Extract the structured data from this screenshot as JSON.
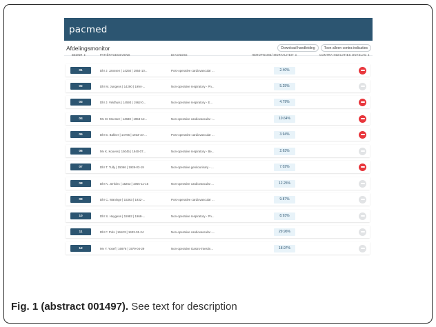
{
  "app": {
    "logo": "pacmed"
  },
  "header": {
    "title": "Afdelingsmonitor",
    "download_label": "Download handleiding",
    "filter_label": "Toon alleen contra-indicaties"
  },
  "columns": {
    "bed": "BEDNR ⇕",
    "patient": "PATIËNTGEGEVENS",
    "diagnosis": "DIAGNOSE",
    "risk": "HEROPNAME/ MORTALITEIT ⇕",
    "contra": "CONTRA-INDICATIES ONTSLAG ⇕"
  },
  "rows": [
    {
      "bed": "01",
      "patient": "Dhr J. Janssen | 14250 | 1954-10...",
      "diagnosis": "Post-operative cardiovascular ...",
      "risk": "2.40%",
      "contra": true
    },
    {
      "bed": "02",
      "patient": "Dhr M. Jungens | 14290 | 1994-...",
      "diagnosis": "Non-operative respiratory - Pn...",
      "risk": "5.25%",
      "contra": false
    },
    {
      "bed": "03",
      "patient": "Dhr J. Veldhuis | 14593 | 1962-0...",
      "diagnosis": "Non-operative respiratory - E...",
      "risk": "4.79%",
      "contra": true
    },
    {
      "bed": "04",
      "patient": "Mv M. Meester | 14688 | 1953-12...",
      "diagnosis": "Non-operative cardiovascular -...",
      "risk": "10.64%",
      "contra": true
    },
    {
      "bed": "05",
      "patient": "Dhr E. Bakker | 14766 | 1933-10-...",
      "diagnosis": "Post-operative cardiovascular ...",
      "risk": "3.94%",
      "contra": true
    },
    {
      "bed": "06",
      "patient": "Mv K. Kooves | 15045 | 1940-07...",
      "diagnosis": "Non-operative respiratory - Be...",
      "risk": "2.63%",
      "contra": false
    },
    {
      "bed": "07",
      "patient": "Dhr T. Tully | 15066 | 1939-03-19",
      "diagnosis": "Non-operative genitourinary - ...",
      "risk": "7.02%",
      "contra": true
    },
    {
      "bed": "08",
      "patient": "Dhr K. Jenkins | 15253 | 1955-11-15",
      "diagnosis": "Non-operative cardiovascular ...",
      "risk": "12.25%",
      "contra": false
    },
    {
      "bed": "09",
      "patient": "Dhr C. Waninge | 15363 | 1932-...",
      "diagnosis": "Post-operative cardiovascular ...",
      "risk": "9.87%",
      "contra": false
    },
    {
      "bed": "10",
      "patient": "Dhr S. Huygens | 15982 | 1968-...",
      "diagnosis": "Non-operative respiratory - Pn...",
      "risk": "8.93%",
      "contra": false
    },
    {
      "bed": "11",
      "patient": "Dhr F. Pols | 16103 | 1933-01-24",
      "diagnosis": "Non-operative cardiovascular -...",
      "risk": "29.96%",
      "contra": false
    },
    {
      "bed": "12",
      "patient": "Mv Y. Yosef | 16976 | 1979-04-29",
      "diagnosis": "Non-operative Gastro-intestin...",
      "risk": "18.97%",
      "contra": false
    }
  ],
  "caption": {
    "label": "Fig. 1 (abstract 001497).",
    "text": " See text for description"
  },
  "colors": {
    "brand": "#2c5571",
    "contra_on": "#e8363c",
    "contra_off": "#e1e3e5"
  }
}
